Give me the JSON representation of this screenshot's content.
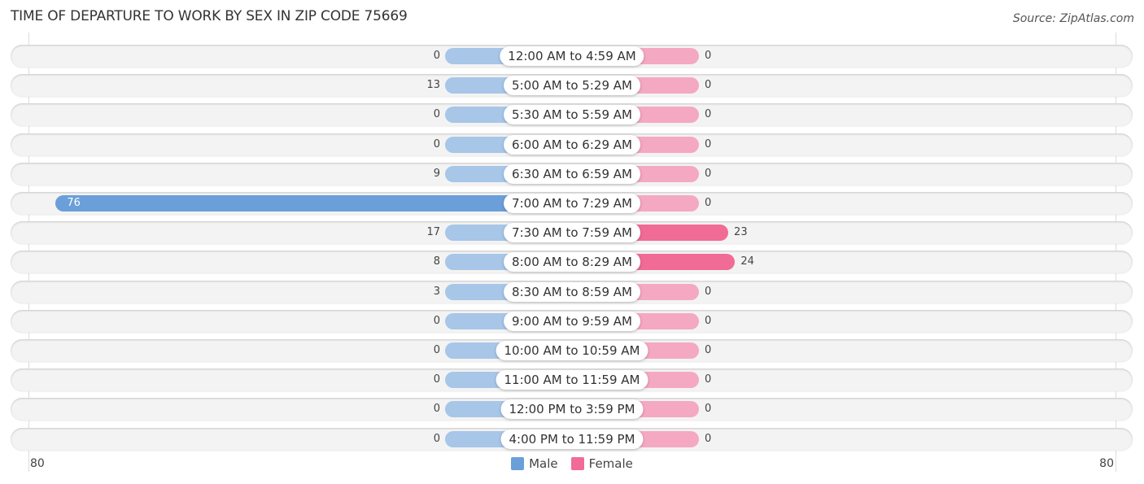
{
  "header": {
    "title": "TIME OF DEPARTURE TO WORK BY SEX IN ZIP CODE 75669",
    "source": "Source: ZipAtlas.com"
  },
  "colors": {
    "male": "#a7c6e8",
    "male_strong": "#6a9fd9",
    "female": "#f5a8c1",
    "female_strong": "#f06b96"
  },
  "chart_data": {
    "type": "bar",
    "orientation": "horizontal-diverging",
    "title": "TIME OF DEPARTURE TO WORK BY SEX IN ZIP CODE 75669",
    "categories": [
      "12:00 AM to 4:59 AM",
      "5:00 AM to 5:29 AM",
      "5:30 AM to 5:59 AM",
      "6:00 AM to 6:29 AM",
      "6:30 AM to 6:59 AM",
      "7:00 AM to 7:29 AM",
      "7:30 AM to 7:59 AM",
      "8:00 AM to 8:29 AM",
      "8:30 AM to 8:59 AM",
      "9:00 AM to 9:59 AM",
      "10:00 AM to 10:59 AM",
      "11:00 AM to 11:59 AM",
      "12:00 PM to 3:59 PM",
      "4:00 PM to 11:59 PM"
    ],
    "series": [
      {
        "name": "Male",
        "values": [
          0,
          13,
          0,
          0,
          9,
          76,
          17,
          8,
          3,
          0,
          0,
          0,
          0,
          0
        ]
      },
      {
        "name": "Female",
        "values": [
          0,
          0,
          0,
          0,
          0,
          0,
          23,
          24,
          0,
          0,
          0,
          0,
          0,
          0
        ]
      }
    ],
    "axis_range": [
      80,
      80
    ],
    "tick_labels": {
      "left": "80",
      "right": "80"
    },
    "legend": {
      "entries": [
        "Male",
        "Female"
      ],
      "position": "bottom-center"
    },
    "grid": false
  }
}
